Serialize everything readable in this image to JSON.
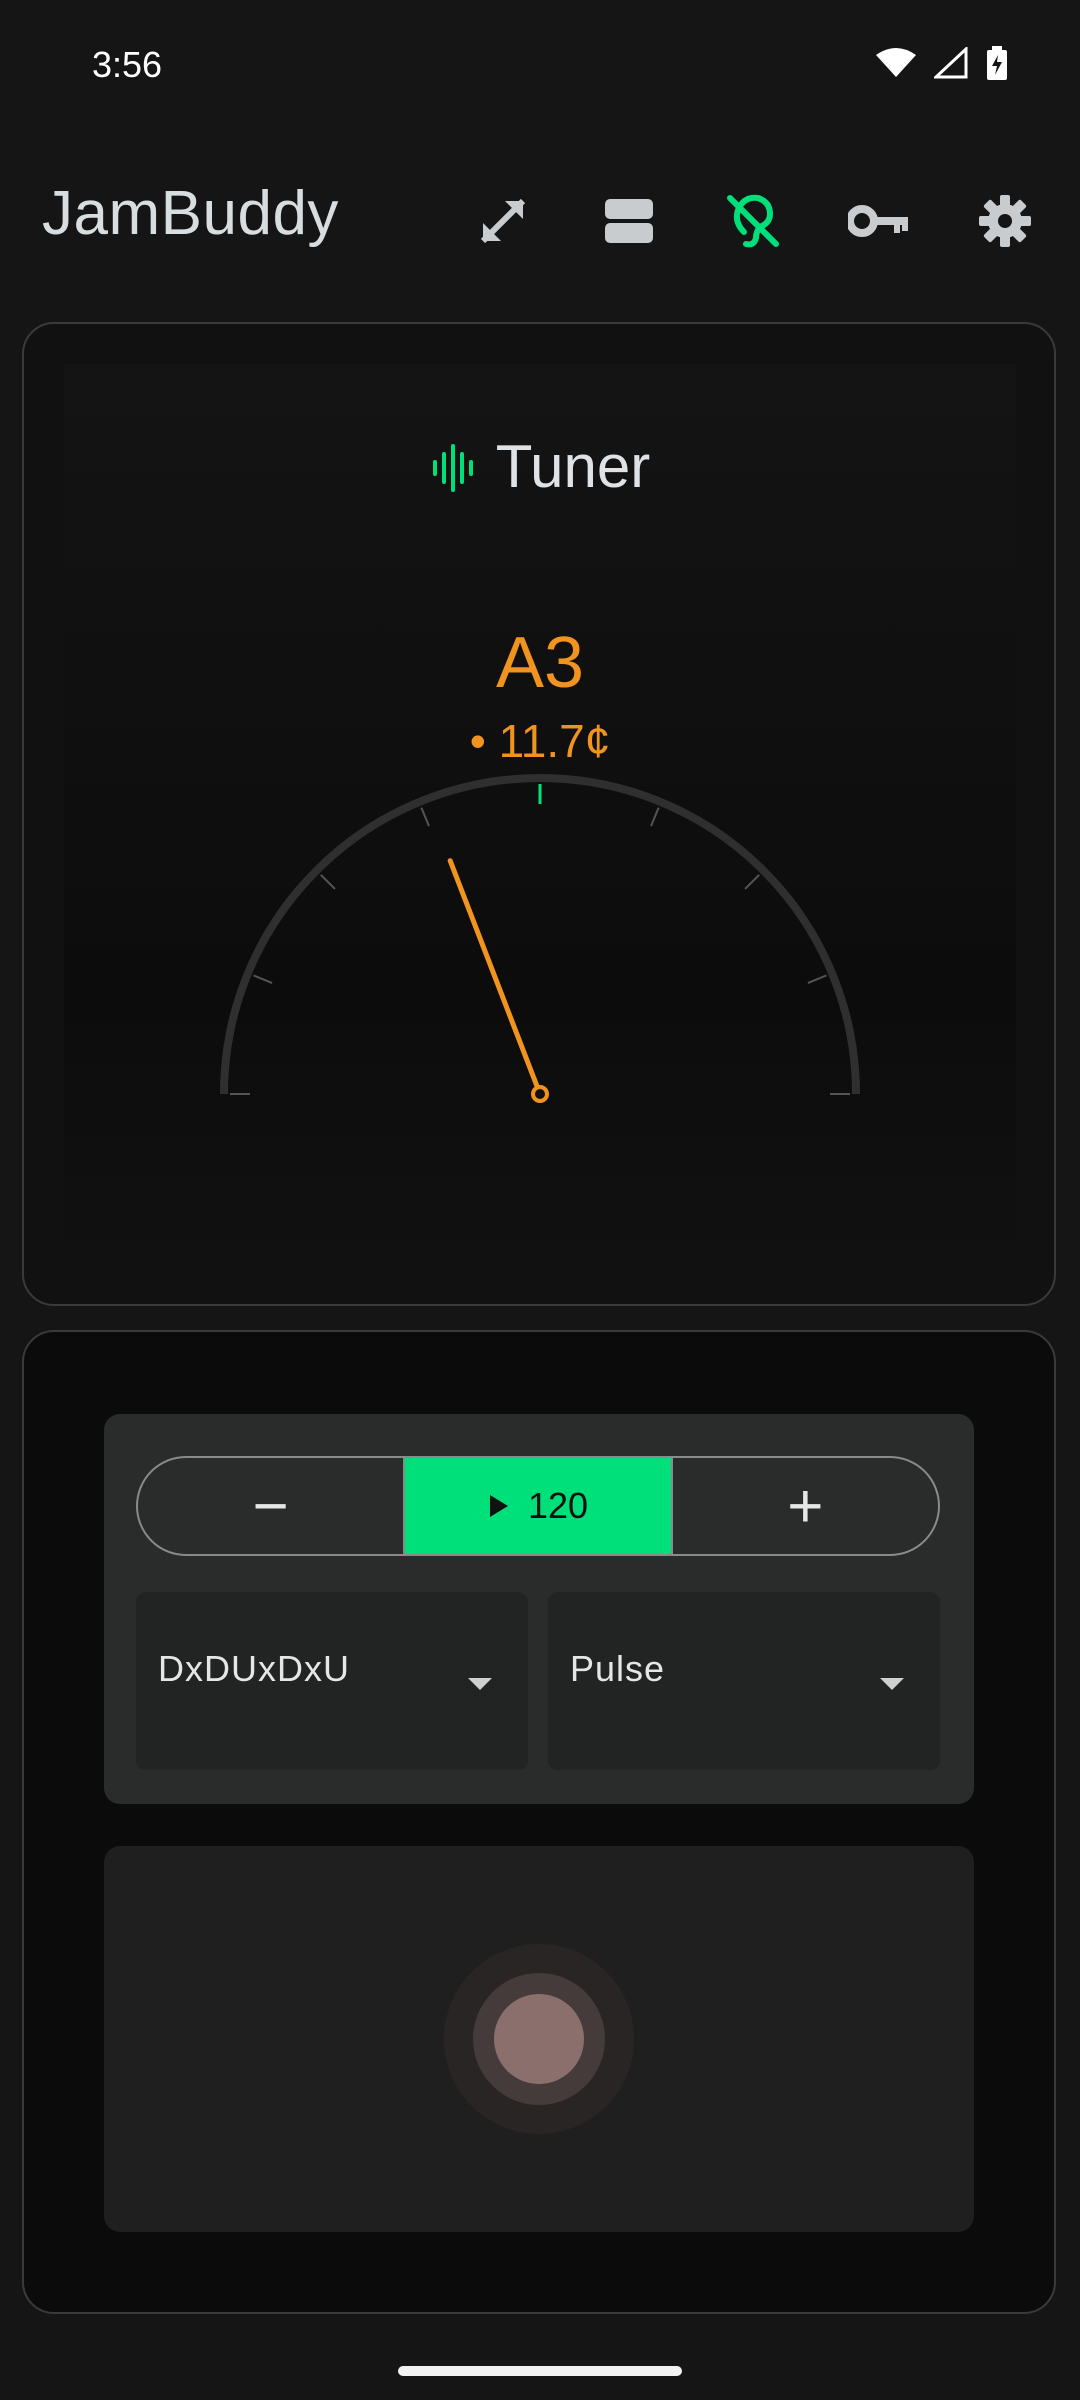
{
  "status_bar": {
    "time": "3:56",
    "icons": [
      "wifi-icon",
      "signal-icon",
      "battery-charging-icon"
    ]
  },
  "app_bar": {
    "title": "JamBuddy",
    "actions": [
      "fullscreen-icon",
      "layout-icon",
      "hearing-off-icon",
      "key-icon",
      "settings-icon"
    ]
  },
  "tuner": {
    "title": "Tuner",
    "icon": "waveform-icon",
    "note": "A3",
    "cents_display": "• 11.7¢",
    "needle_cents": -11.7,
    "colors": {
      "accent": "#f0931f",
      "in_tune": "#00e07a"
    }
  },
  "metronome": {
    "decrement_label": "−",
    "increment_label": "+",
    "bpm": "120",
    "pattern": "DxDUxDxU",
    "sound": "Pulse",
    "colors": {
      "play_bg": "#00e07a"
    }
  }
}
